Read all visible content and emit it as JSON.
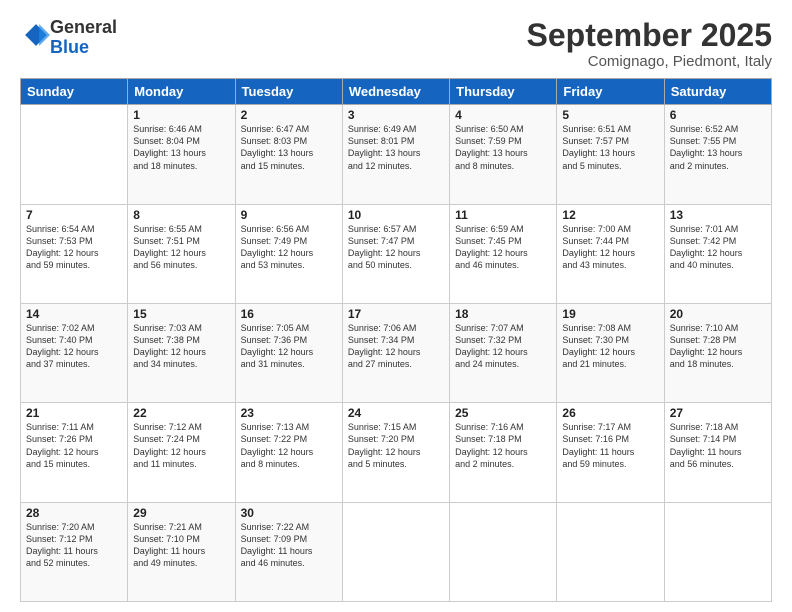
{
  "header": {
    "logo_general": "General",
    "logo_blue": "Blue",
    "title": "September 2025",
    "location": "Comignago, Piedmont, Italy"
  },
  "days_of_week": [
    "Sunday",
    "Monday",
    "Tuesday",
    "Wednesday",
    "Thursday",
    "Friday",
    "Saturday"
  ],
  "weeks": [
    [
      {
        "day": "",
        "info": ""
      },
      {
        "day": "1",
        "info": "Sunrise: 6:46 AM\nSunset: 8:04 PM\nDaylight: 13 hours\nand 18 minutes."
      },
      {
        "day": "2",
        "info": "Sunrise: 6:47 AM\nSunset: 8:03 PM\nDaylight: 13 hours\nand 15 minutes."
      },
      {
        "day": "3",
        "info": "Sunrise: 6:49 AM\nSunset: 8:01 PM\nDaylight: 13 hours\nand 12 minutes."
      },
      {
        "day": "4",
        "info": "Sunrise: 6:50 AM\nSunset: 7:59 PM\nDaylight: 13 hours\nand 8 minutes."
      },
      {
        "day": "5",
        "info": "Sunrise: 6:51 AM\nSunset: 7:57 PM\nDaylight: 13 hours\nand 5 minutes."
      },
      {
        "day": "6",
        "info": "Sunrise: 6:52 AM\nSunset: 7:55 PM\nDaylight: 13 hours\nand 2 minutes."
      }
    ],
    [
      {
        "day": "7",
        "info": "Sunrise: 6:54 AM\nSunset: 7:53 PM\nDaylight: 12 hours\nand 59 minutes."
      },
      {
        "day": "8",
        "info": "Sunrise: 6:55 AM\nSunset: 7:51 PM\nDaylight: 12 hours\nand 56 minutes."
      },
      {
        "day": "9",
        "info": "Sunrise: 6:56 AM\nSunset: 7:49 PM\nDaylight: 12 hours\nand 53 minutes."
      },
      {
        "day": "10",
        "info": "Sunrise: 6:57 AM\nSunset: 7:47 PM\nDaylight: 12 hours\nand 50 minutes."
      },
      {
        "day": "11",
        "info": "Sunrise: 6:59 AM\nSunset: 7:45 PM\nDaylight: 12 hours\nand 46 minutes."
      },
      {
        "day": "12",
        "info": "Sunrise: 7:00 AM\nSunset: 7:44 PM\nDaylight: 12 hours\nand 43 minutes."
      },
      {
        "day": "13",
        "info": "Sunrise: 7:01 AM\nSunset: 7:42 PM\nDaylight: 12 hours\nand 40 minutes."
      }
    ],
    [
      {
        "day": "14",
        "info": "Sunrise: 7:02 AM\nSunset: 7:40 PM\nDaylight: 12 hours\nand 37 minutes."
      },
      {
        "day": "15",
        "info": "Sunrise: 7:03 AM\nSunset: 7:38 PM\nDaylight: 12 hours\nand 34 minutes."
      },
      {
        "day": "16",
        "info": "Sunrise: 7:05 AM\nSunset: 7:36 PM\nDaylight: 12 hours\nand 31 minutes."
      },
      {
        "day": "17",
        "info": "Sunrise: 7:06 AM\nSunset: 7:34 PM\nDaylight: 12 hours\nand 27 minutes."
      },
      {
        "day": "18",
        "info": "Sunrise: 7:07 AM\nSunset: 7:32 PM\nDaylight: 12 hours\nand 24 minutes."
      },
      {
        "day": "19",
        "info": "Sunrise: 7:08 AM\nSunset: 7:30 PM\nDaylight: 12 hours\nand 21 minutes."
      },
      {
        "day": "20",
        "info": "Sunrise: 7:10 AM\nSunset: 7:28 PM\nDaylight: 12 hours\nand 18 minutes."
      }
    ],
    [
      {
        "day": "21",
        "info": "Sunrise: 7:11 AM\nSunset: 7:26 PM\nDaylight: 12 hours\nand 15 minutes."
      },
      {
        "day": "22",
        "info": "Sunrise: 7:12 AM\nSunset: 7:24 PM\nDaylight: 12 hours\nand 11 minutes."
      },
      {
        "day": "23",
        "info": "Sunrise: 7:13 AM\nSunset: 7:22 PM\nDaylight: 12 hours\nand 8 minutes."
      },
      {
        "day": "24",
        "info": "Sunrise: 7:15 AM\nSunset: 7:20 PM\nDaylight: 12 hours\nand 5 minutes."
      },
      {
        "day": "25",
        "info": "Sunrise: 7:16 AM\nSunset: 7:18 PM\nDaylight: 12 hours\nand 2 minutes."
      },
      {
        "day": "26",
        "info": "Sunrise: 7:17 AM\nSunset: 7:16 PM\nDaylight: 11 hours\nand 59 minutes."
      },
      {
        "day": "27",
        "info": "Sunrise: 7:18 AM\nSunset: 7:14 PM\nDaylight: 11 hours\nand 56 minutes."
      }
    ],
    [
      {
        "day": "28",
        "info": "Sunrise: 7:20 AM\nSunset: 7:12 PM\nDaylight: 11 hours\nand 52 minutes."
      },
      {
        "day": "29",
        "info": "Sunrise: 7:21 AM\nSunset: 7:10 PM\nDaylight: 11 hours\nand 49 minutes."
      },
      {
        "day": "30",
        "info": "Sunrise: 7:22 AM\nSunset: 7:09 PM\nDaylight: 11 hours\nand 46 minutes."
      },
      {
        "day": "",
        "info": ""
      },
      {
        "day": "",
        "info": ""
      },
      {
        "day": "",
        "info": ""
      },
      {
        "day": "",
        "info": ""
      }
    ]
  ]
}
